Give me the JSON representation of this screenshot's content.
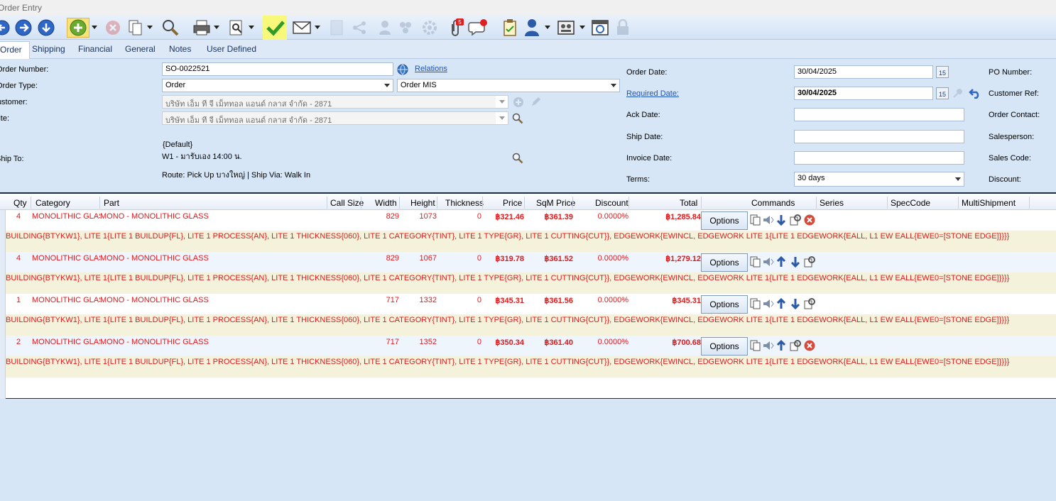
{
  "window": {
    "title": "Order Entry"
  },
  "tabs": [
    {
      "label": "Order"
    },
    {
      "label": "Shipping"
    },
    {
      "label": "Financial"
    },
    {
      "label": "General"
    },
    {
      "label": "Notes"
    },
    {
      "label": "User Defined"
    }
  ],
  "form": {
    "order_number": {
      "label": "Order Number:",
      "value": "SO-0022521"
    },
    "relations_link": "Relations",
    "order_type": {
      "label": "Order Type:",
      "value": "Order",
      "value2": "Order MIS"
    },
    "customer": {
      "label": "Customer:",
      "value": "บริษัท เอ็ม ที จี เม็ททอล แอนด์ กลาส จำกัด - 2871"
    },
    "site": {
      "label": "Site:",
      "value": "บริษัท เอ็ม ที จี เม็ททอล แอนด์ กลาส จำกัด - 2871"
    },
    "ship_to": {
      "label": "Ship To:",
      "line1": "{Default}",
      "line2": "W1 - มารับเอง 14:00 น.",
      "route": "Route: Pick Up บางใหญ่  |  Ship Via: Walk In"
    },
    "order_date": {
      "label": "Order Date:",
      "value": "30/04/2025"
    },
    "required_date": {
      "label": "Required Date:",
      "value": "30/04/2025"
    },
    "ack_date": {
      "label": "Ack Date:",
      "value": ""
    },
    "ship_date": {
      "label": "Ship Date:",
      "value": ""
    },
    "invoice_date": {
      "label": "Invoice Date:",
      "value": ""
    },
    "terms": {
      "label": "Terms:",
      "value": "30 days"
    },
    "calendar_label": "15",
    "right_labels": {
      "po_number": "PO Number:",
      "customer_ref": "Customer Ref:",
      "order_contact": "Order Contact:",
      "salesperson": "Salesperson:",
      "sales_code": "Sales Code:",
      "discount": "Discount:"
    }
  },
  "grid": {
    "columns": [
      "Qty",
      "Category",
      "Part",
      "Call Size",
      "Width",
      "Height",
      "Thickness",
      "Price",
      "SqM Price",
      "Discount",
      "Total",
      "Commands",
      "Series",
      "SpecCode",
      "MultiShipment"
    ],
    "options_label": "Options",
    "rows": [
      {
        "qty": "4",
        "category": "MONOLITHIC GLASS",
        "part": "MONO - MONOLITHIC GLASS",
        "width": "829",
        "height": "1073",
        "thickness": "0",
        "price": "฿321.46",
        "sqm_price": "฿361.39",
        "discount": "0.0000%",
        "total": "฿1,285.84",
        "desc": "BUILDING{BTYKW1}, LITE 1{LITE 1 BUILDUP{FL}, LITE 1 PROCESS{AN}, LITE 1 THICKNESS{060}, LITE 1 CATEGORY{TINT}, LITE 1 TYPE{GR}, LITE 1 CUTTING{CUT}}, EDGEWORK{EWINCL, EDGEWORK LITE 1{LITE 1 EDGEWORK{EALL, L1 EW EALL{EWE0=[STONE EDGE]}}}}"
      },
      {
        "qty": "4",
        "category": "MONOLITHIC GLASS",
        "part": "MONO - MONOLITHIC GLASS",
        "width": "829",
        "height": "1067",
        "thickness": "0",
        "price": "฿319.78",
        "sqm_price": "฿361.52",
        "discount": "0.0000%",
        "total": "฿1,279.12",
        "desc": "BUILDING{BTYKW1}, LITE 1{LITE 1 BUILDUP{FL}, LITE 1 PROCESS{AN}, LITE 1 THICKNESS{060}, LITE 1 CATEGORY{TINT}, LITE 1 TYPE{GR}, LITE 1 CUTTING{CUT}}, EDGEWORK{EWINCL, EDGEWORK LITE 1{LITE 1 EDGEWORK{EALL, L1 EW EALL{EWE0=[STONE EDGE]}}}}"
      },
      {
        "qty": "1",
        "category": "MONOLITHIC GLASS",
        "part": "MONO - MONOLITHIC GLASS",
        "width": "717",
        "height": "1332",
        "thickness": "0",
        "price": "฿345.31",
        "sqm_price": "฿361.56",
        "discount": "0.0000%",
        "total": "฿345.31",
        "desc": "BUILDING{BTYKW1}, LITE 1{LITE 1 BUILDUP{FL}, LITE 1 PROCESS{AN}, LITE 1 THICKNESS{060}, LITE 1 CATEGORY{TINT}, LITE 1 TYPE{GR}, LITE 1 CUTTING{CUT}}, EDGEWORK{EWINCL, EDGEWORK LITE 1{LITE 1 EDGEWORK{EALL, L1 EW EALL{EWE0=[STONE EDGE]}}}}"
      },
      {
        "qty": "2",
        "category": "MONOLITHIC GLASS",
        "part": "MONO - MONOLITHIC GLASS",
        "width": "717",
        "height": "1352",
        "thickness": "0",
        "price": "฿350.34",
        "sqm_price": "฿361.40",
        "discount": "0.0000%",
        "total": "฿700.68",
        "desc": "BUILDING{BTYKW1}, LITE 1{LITE 1 BUILDUP{FL}, LITE 1 PROCESS{AN}, LITE 1 THICKNESS{060}, LITE 1 CATEGORY{TINT}, LITE 1 TYPE{GR}, LITE 1 CUTTING{CUT}}, EDGEWORK{EWINCL, EDGEWORK LITE 1{LITE 1 EDGEWORK{EALL, L1 EW EALL{EWE0=[STONE EDGE]}}}}"
      }
    ]
  },
  "icons": {
    "toolbar": [
      "back-icon",
      "forward-icon",
      "down-icon",
      "add-icon",
      "cancel-icon",
      "copy-icon",
      "search-icon",
      "print-icon",
      "preview-icon",
      "approve-icon",
      "email-icon",
      "document-icon",
      "share-icon",
      "user-icon",
      "group-icon",
      "settings-icon",
      "attachment-icon",
      "comment-icon",
      "clipboard-icon",
      "person-icon",
      "monitor-icon",
      "schedule-icon",
      "lock-icon"
    ],
    "attachment_badge": "5"
  },
  "colors": {
    "accent": "#1f53b5",
    "line_text": "#e0191c",
    "highlight": "#f8f87a",
    "background": "#d6e6f7"
  }
}
